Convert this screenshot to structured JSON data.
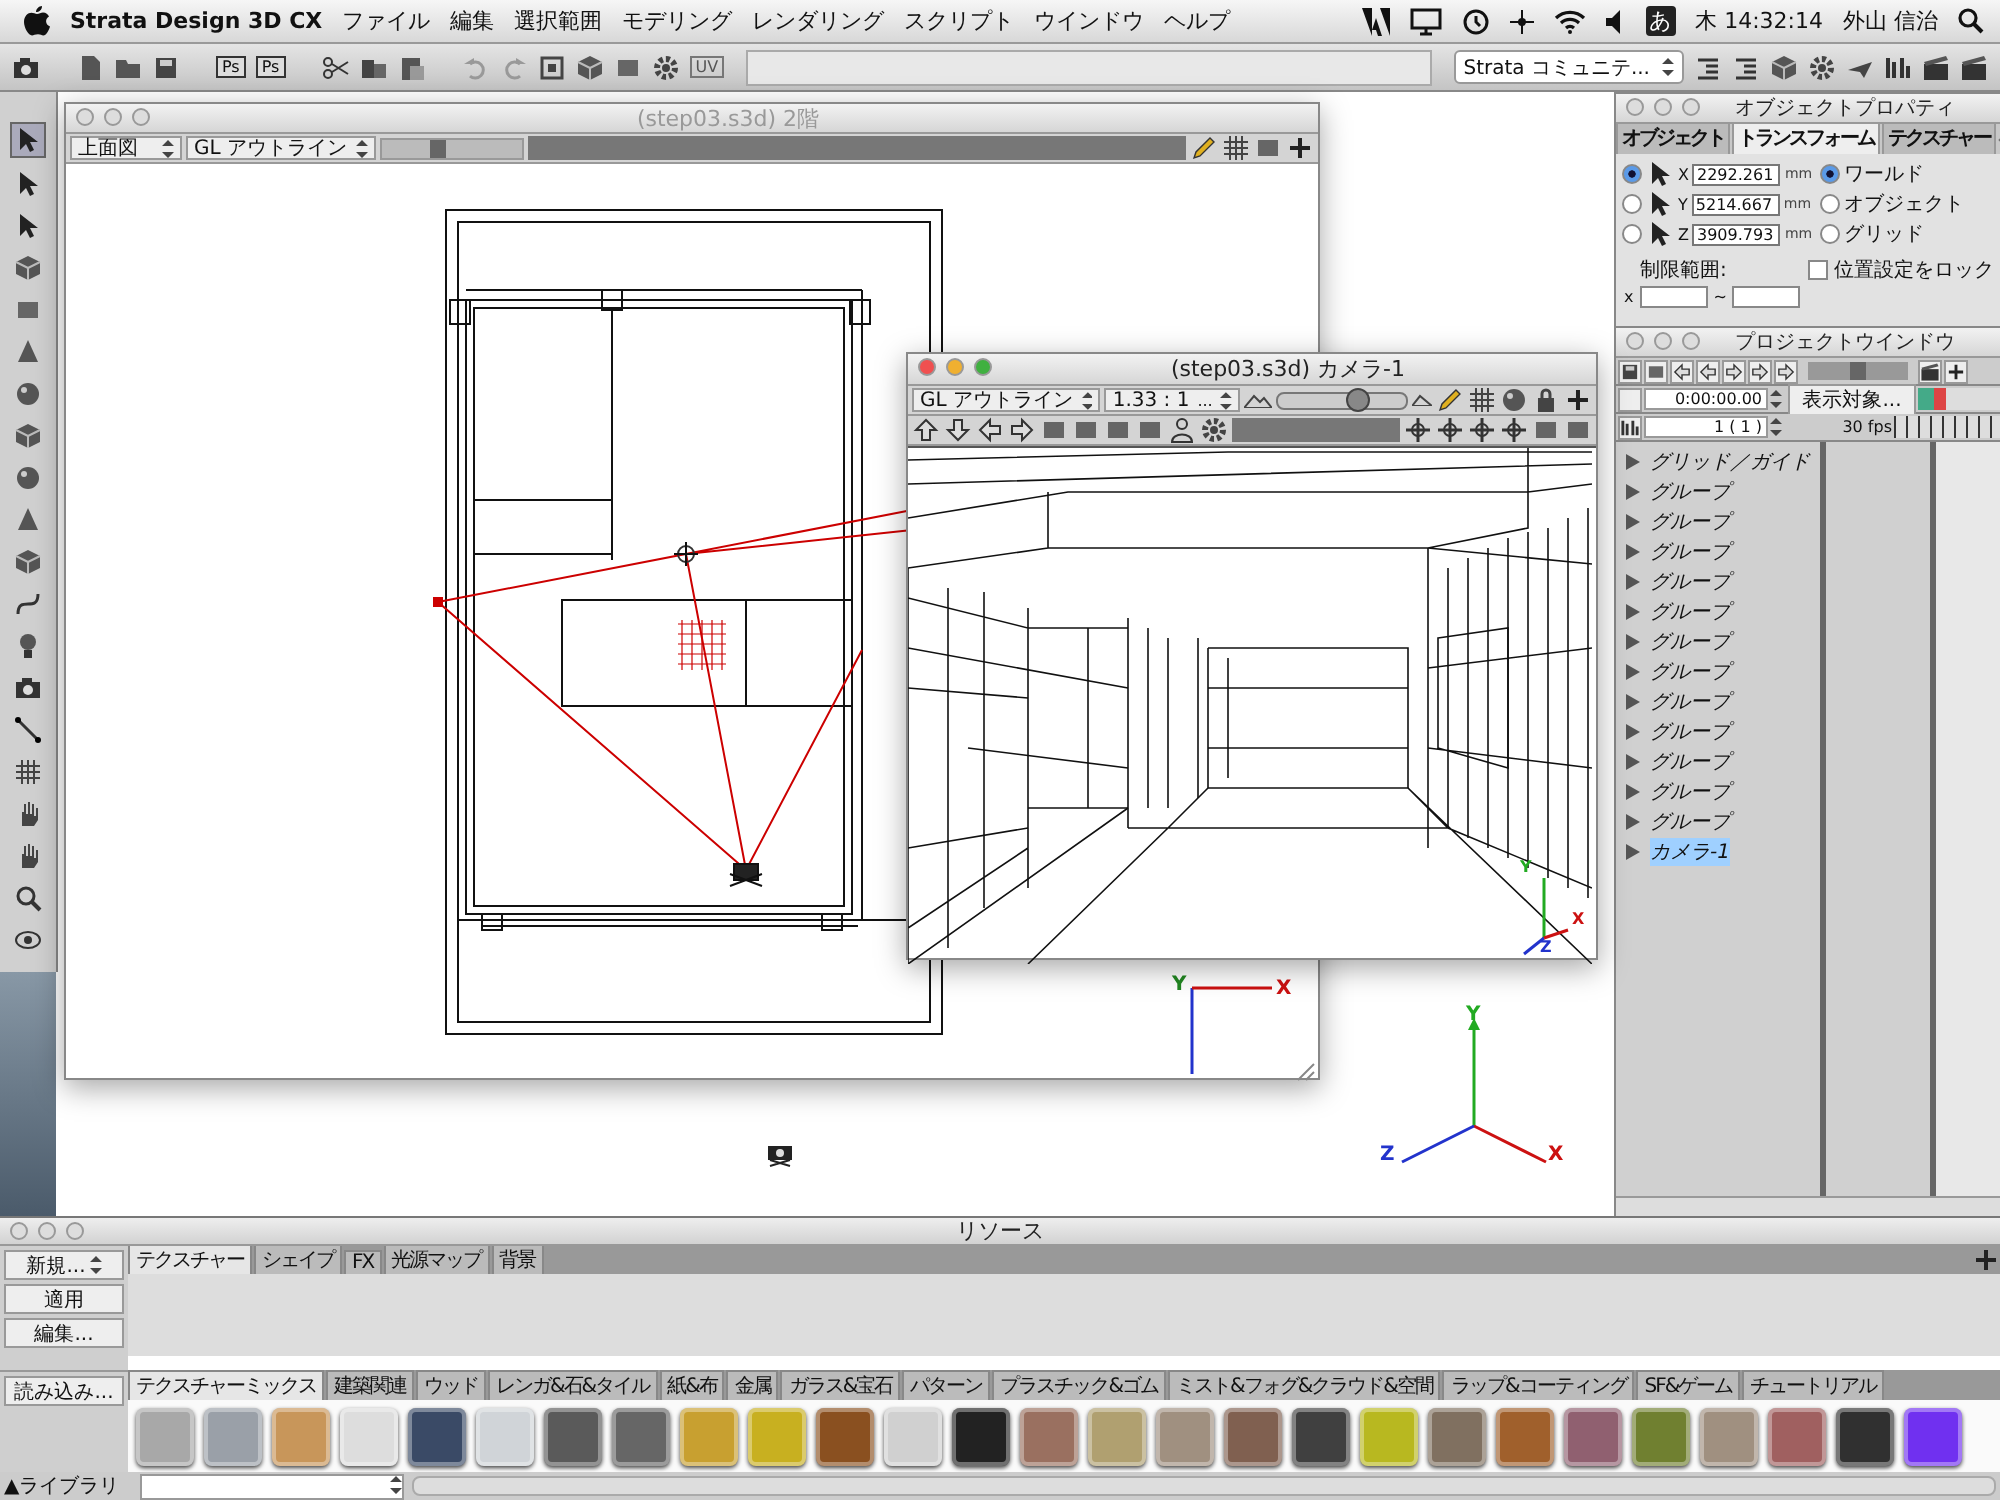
{
  "menubar": {
    "app": "Strata Design 3D CX",
    "menus": [
      "ファイル",
      "編集",
      "選択範囲",
      "モデリング",
      "レンダリング",
      "スクリプト",
      "ウインドウ",
      "ヘルプ"
    ],
    "input_method": "あ",
    "clock": "木 14:32:14",
    "user": "外山 信治"
  },
  "toolbar": {
    "ps_buttons": [
      "Ps",
      "Ps"
    ],
    "uv_button": "UV",
    "community": "Strata コミュニテ..."
  },
  "plan_window": {
    "title": "(step03.s3d) 2階",
    "view": "上面図",
    "render": "GL アウトライン",
    "zoom": {
      "level": 0.4
    },
    "axes": [
      "Y",
      "X"
    ]
  },
  "camera_window": {
    "title": "(step03.s3d) カメラ-1",
    "render": "GL アウトライン",
    "ratio": "1.33 : 1",
    "ratio_menu": "...",
    "zoom": {
      "level": 0.62
    },
    "axes": [
      "Y",
      "Z",
      "X"
    ]
  },
  "world_axes": [
    "Y",
    "Z",
    "X"
  ],
  "object_properties": {
    "title": "オブジェクトプロパティ",
    "tabs": [
      {
        "label": "オブジェクト",
        "selected": false
      },
      {
        "label": "トランスフォーム",
        "selected": true
      },
      {
        "label": "テクスチャー",
        "selected": false
      }
    ],
    "coords": [
      {
        "axis": "X",
        "value": "2292.261",
        "unit": "mm",
        "selected": true
      },
      {
        "axis": "Y",
        "value": "5214.667",
        "unit": "mm",
        "selected": false
      },
      {
        "axis": "Z",
        "value": "3909.793",
        "unit": "mm",
        "selected": false
      }
    ],
    "spaces": [
      {
        "label": "ワールド",
        "selected": true
      },
      {
        "label": "オブジェクト",
        "selected": false
      },
      {
        "label": "グリッド",
        "selected": false
      }
    ],
    "limit_label": "制限範囲:",
    "limit_axis": "x",
    "limit_sep": "~",
    "lock": {
      "label": "位置設定をロック",
      "checked": false
    }
  },
  "project_window": {
    "title": "プロジェクトウインドウ",
    "timeline_zoom": {
      "level": 0.5
    },
    "time": "0:00:00.00",
    "frame": "1 ( 1 )",
    "filter_button": "表示対象...",
    "fps": "30 fps",
    "items": [
      {
        "label": "グリッド／ガイド",
        "selected": false
      },
      {
        "label": "グループ",
        "selected": false
      },
      {
        "label": "グループ",
        "selected": false
      },
      {
        "label": "グループ",
        "selected": false
      },
      {
        "label": "グループ",
        "selected": false
      },
      {
        "label": "グループ",
        "selected": false
      },
      {
        "label": "グループ",
        "selected": false
      },
      {
        "label": "グループ",
        "selected": false
      },
      {
        "label": "グループ",
        "selected": false
      },
      {
        "label": "グループ",
        "selected": false
      },
      {
        "label": "グループ",
        "selected": false
      },
      {
        "label": "グループ",
        "selected": false
      },
      {
        "label": "グループ",
        "selected": false
      },
      {
        "label": "カメラ-1",
        "selected": true
      }
    ]
  },
  "resources": {
    "title": "リソース",
    "new_button": "新規...",
    "apply_button": "適用",
    "edit_button": "編集...",
    "tabs": [
      {
        "label": "テクスチャー",
        "selected": true
      },
      {
        "label": "シェイプ",
        "selected": false
      },
      {
        "label": "FX",
        "selected": false
      },
      {
        "label": "光源マップ",
        "selected": false
      },
      {
        "label": "背景",
        "selected": false
      }
    ],
    "load_button": "読み込み...",
    "categories": [
      {
        "label": "テクスチャーミックス",
        "selected": true
      },
      {
        "label": "建築関連",
        "selected": false
      },
      {
        "label": "ウッド",
        "selected": false
      },
      {
        "label": "レンガ&石&タイル",
        "selected": false
      },
      {
        "label": "紙&布",
        "selected": false
      },
      {
        "label": "金属",
        "selected": false
      },
      {
        "label": "ガラス&宝石",
        "selected": false
      },
      {
        "label": "パターン",
        "selected": false
      },
      {
        "label": "プラスチック&ゴム",
        "selected": false
      },
      {
        "label": "ミスト&フォグ&クラウド&空間",
        "selected": false
      },
      {
        "label": "ラップ&コーティング",
        "selected": false
      },
      {
        "label": "SF&ゲーム",
        "selected": false
      },
      {
        "label": "チュートリアル",
        "selected": false
      }
    ],
    "swatches": [
      {
        "color": "#a8a8a8"
      },
      {
        "color": "#9aa0a8"
      },
      {
        "color": "#c8965a"
      },
      {
        "color": "#dddddd"
      },
      {
        "color": "#3a4a66"
      },
      {
        "color": "#d0d4d8"
      },
      {
        "color": "#5a5a5a"
      },
      {
        "color": "#666666"
      },
      {
        "color": "#c8a030"
      },
      {
        "color": "#c8b020"
      },
      {
        "color": "#8a5020"
      },
      {
        "color": "#d0d0d0"
      },
      {
        "color": "#222222"
      },
      {
        "color": "#9a7060"
      },
      {
        "color": "#b0a070"
      },
      {
        "color": "#a09080"
      },
      {
        "color": "#806050"
      },
      {
        "color": "#404040"
      },
      {
        "color": "#b8b820"
      },
      {
        "color": "#807060"
      },
      {
        "color": "#a0602c"
      },
      {
        "color": "#906070"
      },
      {
        "color": "#708030"
      },
      {
        "color": "#a09080"
      },
      {
        "color": "#a06060"
      },
      {
        "color": "#303030"
      },
      {
        "color": "#7030f0"
      }
    ],
    "library": "▲ライブラリ"
  }
}
